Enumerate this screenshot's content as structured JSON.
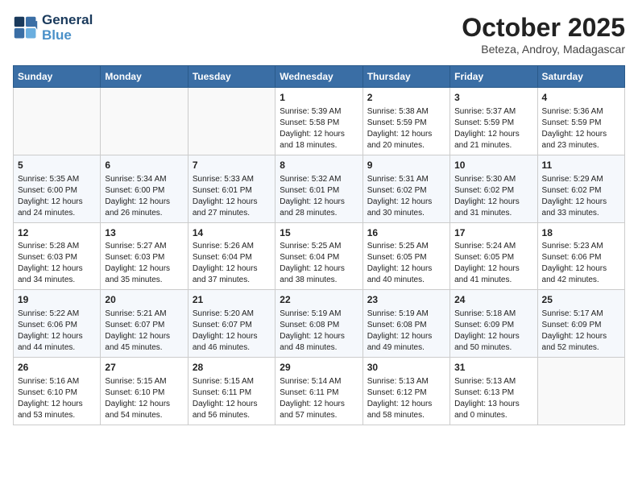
{
  "header": {
    "logo_line1": "General",
    "logo_line2": "Blue",
    "month": "October 2025",
    "location": "Beteza, Androy, Madagascar"
  },
  "weekdays": [
    "Sunday",
    "Monday",
    "Tuesday",
    "Wednesday",
    "Thursday",
    "Friday",
    "Saturday"
  ],
  "weeks": [
    [
      {
        "day": "",
        "info": ""
      },
      {
        "day": "",
        "info": ""
      },
      {
        "day": "",
        "info": ""
      },
      {
        "day": "1",
        "info": "Sunrise: 5:39 AM\nSunset: 5:58 PM\nDaylight: 12 hours\nand 18 minutes."
      },
      {
        "day": "2",
        "info": "Sunrise: 5:38 AM\nSunset: 5:59 PM\nDaylight: 12 hours\nand 20 minutes."
      },
      {
        "day": "3",
        "info": "Sunrise: 5:37 AM\nSunset: 5:59 PM\nDaylight: 12 hours\nand 21 minutes."
      },
      {
        "day": "4",
        "info": "Sunrise: 5:36 AM\nSunset: 5:59 PM\nDaylight: 12 hours\nand 23 minutes."
      }
    ],
    [
      {
        "day": "5",
        "info": "Sunrise: 5:35 AM\nSunset: 6:00 PM\nDaylight: 12 hours\nand 24 minutes."
      },
      {
        "day": "6",
        "info": "Sunrise: 5:34 AM\nSunset: 6:00 PM\nDaylight: 12 hours\nand 26 minutes."
      },
      {
        "day": "7",
        "info": "Sunrise: 5:33 AM\nSunset: 6:01 PM\nDaylight: 12 hours\nand 27 minutes."
      },
      {
        "day": "8",
        "info": "Sunrise: 5:32 AM\nSunset: 6:01 PM\nDaylight: 12 hours\nand 28 minutes."
      },
      {
        "day": "9",
        "info": "Sunrise: 5:31 AM\nSunset: 6:02 PM\nDaylight: 12 hours\nand 30 minutes."
      },
      {
        "day": "10",
        "info": "Sunrise: 5:30 AM\nSunset: 6:02 PM\nDaylight: 12 hours\nand 31 minutes."
      },
      {
        "day": "11",
        "info": "Sunrise: 5:29 AM\nSunset: 6:02 PM\nDaylight: 12 hours\nand 33 minutes."
      }
    ],
    [
      {
        "day": "12",
        "info": "Sunrise: 5:28 AM\nSunset: 6:03 PM\nDaylight: 12 hours\nand 34 minutes."
      },
      {
        "day": "13",
        "info": "Sunrise: 5:27 AM\nSunset: 6:03 PM\nDaylight: 12 hours\nand 35 minutes."
      },
      {
        "day": "14",
        "info": "Sunrise: 5:26 AM\nSunset: 6:04 PM\nDaylight: 12 hours\nand 37 minutes."
      },
      {
        "day": "15",
        "info": "Sunrise: 5:25 AM\nSunset: 6:04 PM\nDaylight: 12 hours\nand 38 minutes."
      },
      {
        "day": "16",
        "info": "Sunrise: 5:25 AM\nSunset: 6:05 PM\nDaylight: 12 hours\nand 40 minutes."
      },
      {
        "day": "17",
        "info": "Sunrise: 5:24 AM\nSunset: 6:05 PM\nDaylight: 12 hours\nand 41 minutes."
      },
      {
        "day": "18",
        "info": "Sunrise: 5:23 AM\nSunset: 6:06 PM\nDaylight: 12 hours\nand 42 minutes."
      }
    ],
    [
      {
        "day": "19",
        "info": "Sunrise: 5:22 AM\nSunset: 6:06 PM\nDaylight: 12 hours\nand 44 minutes."
      },
      {
        "day": "20",
        "info": "Sunrise: 5:21 AM\nSunset: 6:07 PM\nDaylight: 12 hours\nand 45 minutes."
      },
      {
        "day": "21",
        "info": "Sunrise: 5:20 AM\nSunset: 6:07 PM\nDaylight: 12 hours\nand 46 minutes."
      },
      {
        "day": "22",
        "info": "Sunrise: 5:19 AM\nSunset: 6:08 PM\nDaylight: 12 hours\nand 48 minutes."
      },
      {
        "day": "23",
        "info": "Sunrise: 5:19 AM\nSunset: 6:08 PM\nDaylight: 12 hours\nand 49 minutes."
      },
      {
        "day": "24",
        "info": "Sunrise: 5:18 AM\nSunset: 6:09 PM\nDaylight: 12 hours\nand 50 minutes."
      },
      {
        "day": "25",
        "info": "Sunrise: 5:17 AM\nSunset: 6:09 PM\nDaylight: 12 hours\nand 52 minutes."
      }
    ],
    [
      {
        "day": "26",
        "info": "Sunrise: 5:16 AM\nSunset: 6:10 PM\nDaylight: 12 hours\nand 53 minutes."
      },
      {
        "day": "27",
        "info": "Sunrise: 5:15 AM\nSunset: 6:10 PM\nDaylight: 12 hours\nand 54 minutes."
      },
      {
        "day": "28",
        "info": "Sunrise: 5:15 AM\nSunset: 6:11 PM\nDaylight: 12 hours\nand 56 minutes."
      },
      {
        "day": "29",
        "info": "Sunrise: 5:14 AM\nSunset: 6:11 PM\nDaylight: 12 hours\nand 57 minutes."
      },
      {
        "day": "30",
        "info": "Sunrise: 5:13 AM\nSunset: 6:12 PM\nDaylight: 12 hours\nand 58 minutes."
      },
      {
        "day": "31",
        "info": "Sunrise: 5:13 AM\nSunset: 6:13 PM\nDaylight: 13 hours\nand 0 minutes."
      },
      {
        "day": "",
        "info": ""
      }
    ]
  ]
}
